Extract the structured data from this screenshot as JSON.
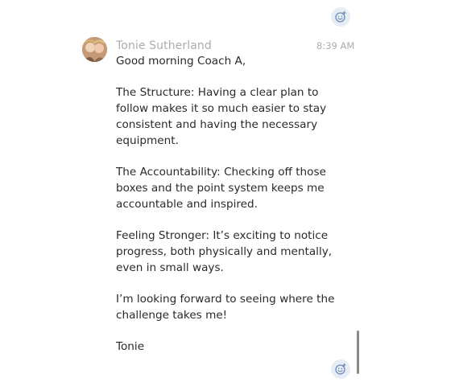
{
  "colors": {
    "background": "#ffffff",
    "muted_text": "#a9adb3",
    "body_text": "#2a2a2a",
    "reaction_bg": "#e6edf5",
    "reaction_icon": "#6f8fb8"
  },
  "reaction_buttons": [
    {
      "icon": "add-reaction-icon"
    },
    {
      "icon": "add-reaction-icon"
    }
  ],
  "message": {
    "sender": "Tonie Sutherland",
    "time": "8:39 AM",
    "avatar_icon": "user-avatar",
    "paragraphs": [
      "Good morning Coach A,",
      "The Structure: Having a clear plan to follow makes it so much easier to stay consistent and having the necessary equipment.",
      "The Accountability: Checking off those boxes and the point system keeps me accountable and inspired.",
      "Feeling Stronger: It’s exciting to notice progress, both physically and mentally, even in small ways.",
      "I’m looking forward to seeing where the challenge takes me!",
      "Tonie"
    ]
  }
}
